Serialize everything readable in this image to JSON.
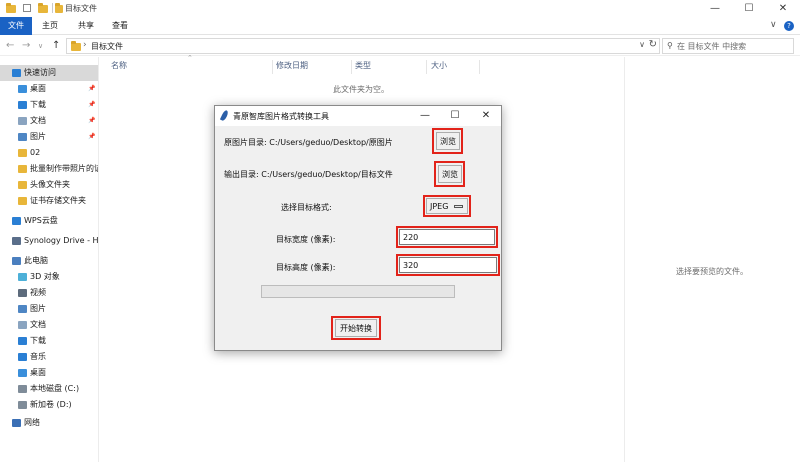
{
  "window": {
    "title": "目标文件",
    "minimize": "—",
    "maximize": "☐",
    "close": "✕"
  },
  "ribbon": {
    "tabs": [
      "文件",
      "主页",
      "共享",
      "查看"
    ],
    "collapse": "∨",
    "help": "?"
  },
  "address": {
    "path": "目标文件",
    "search_placeholder": "在 目标文件 中搜索"
  },
  "sidebar": {
    "items": [
      {
        "label": "快速访问",
        "icon": "star-icon",
        "pinned": false
      },
      {
        "label": "桌面",
        "icon": "desktop-icon",
        "pinned": true
      },
      {
        "label": "下载",
        "icon": "download-icon",
        "pinned": true
      },
      {
        "label": "文档",
        "icon": "document-icon",
        "pinned": true
      },
      {
        "label": "图片",
        "icon": "picture-icon",
        "pinned": true
      },
      {
        "label": "02",
        "icon": "folder-icon",
        "pinned": false
      },
      {
        "label": "批量制作带照片的证",
        "icon": "folder-icon",
        "pinned": false
      },
      {
        "label": "头像文件夹",
        "icon": "folder-icon",
        "pinned": false
      },
      {
        "label": "证书存储文件夹",
        "icon": "folder-icon",
        "pinned": false
      },
      {
        "label": "WPS云盘",
        "icon": "cloud-icon",
        "pinned": false
      },
      {
        "label": "Synology Drive - HO",
        "icon": "drive-icon",
        "pinned": false
      },
      {
        "label": "此电脑",
        "icon": "computer-icon",
        "pinned": false
      },
      {
        "label": "3D 对象",
        "icon": "cube-icon",
        "pinned": false
      },
      {
        "label": "视频",
        "icon": "video-icon",
        "pinned": false
      },
      {
        "label": "图片",
        "icon": "picture-icon",
        "pinned": false
      },
      {
        "label": "文档",
        "icon": "document-icon",
        "pinned": false
      },
      {
        "label": "下载",
        "icon": "download-icon",
        "pinned": false
      },
      {
        "label": "音乐",
        "icon": "music-icon",
        "pinned": false
      },
      {
        "label": "桌面",
        "icon": "desktop-icon",
        "pinned": false
      },
      {
        "label": "本地磁盘 (C:)",
        "icon": "disk-icon",
        "pinned": false
      },
      {
        "label": "新加卷 (D:)",
        "icon": "disk-icon",
        "pinned": false
      },
      {
        "label": "网络",
        "icon": "network-icon",
        "pinned": false
      }
    ]
  },
  "filelist": {
    "columns": [
      "名称",
      "修改日期",
      "类型",
      "大小"
    ],
    "empty_message": "此文件夹为空。"
  },
  "preview": {
    "message": "选择要预览的文件。"
  },
  "dialog": {
    "title": "青原智库图片格式转换工具",
    "source_dir_label": "原图片目录: C:/Users/geduo/Desktop/原图片",
    "browse_label": "浏览",
    "output_dir_label": "输出目录: C:/Users/geduo/Desktop/目标文件",
    "format_label": "选择目标格式:",
    "format_value": "JPEG",
    "width_label": "目标宽度 (像素):",
    "width_value": "220",
    "height_label": "目标高度 (像素):",
    "height_value": "320",
    "progress_value": 0,
    "start_label": "开始转换",
    "minimize": "—",
    "maximize": "☐",
    "close": "✕"
  },
  "colors": {
    "highlight": "#e2231a",
    "ribbon_active": "#1a62c4",
    "folder": "#e8b63a"
  }
}
